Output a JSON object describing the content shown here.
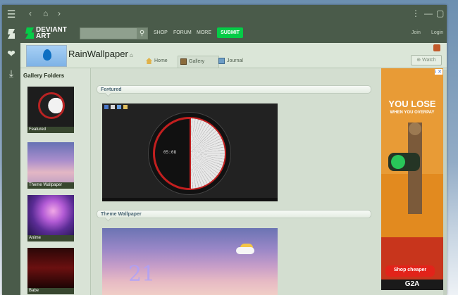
{
  "window": {
    "controls": [
      "‹",
      "›",
      "⋮",
      "—",
      "▢",
      "✕"
    ]
  },
  "sidebar": {
    "icons": [
      "menu-icon",
      "deviantart-icon",
      "heart-icon",
      "download-icon"
    ]
  },
  "nav": {
    "logo_line1": "DEVIANT",
    "logo_line2": "ART",
    "links": [
      "SHOP",
      "FORUM",
      "MORE"
    ],
    "submit": "SUBMIT",
    "join": "Join",
    "login": "Login",
    "search_placeholder": ""
  },
  "profile": {
    "username": "RainWallpaper",
    "tabs": [
      "Home",
      "Gallery",
      "Journal"
    ],
    "active_tab": "Gallery",
    "watch": "Watch"
  },
  "gallery": {
    "heading": "Gallery Folders",
    "folders": [
      {
        "label": "Featured"
      },
      {
        "label": "Theme Wallpaper"
      },
      {
        "label": "Anime"
      },
      {
        "label": "Babe"
      }
    ],
    "sections": [
      {
        "title": "Featured"
      },
      {
        "title": "Theme Wallpaper"
      }
    ],
    "clock_time": "05:08",
    "wallpaper_number": "21"
  },
  "ad": {
    "headline": "YOU LOSE",
    "subline": "WHEN YOU OVERPAY",
    "cta": "Shop cheaper",
    "brand": "G2A",
    "badge": "i ✕"
  },
  "colors": {
    "chrome": "#4a5b4a",
    "accent": "#05cc47",
    "page_bg": "#d3ded0"
  }
}
